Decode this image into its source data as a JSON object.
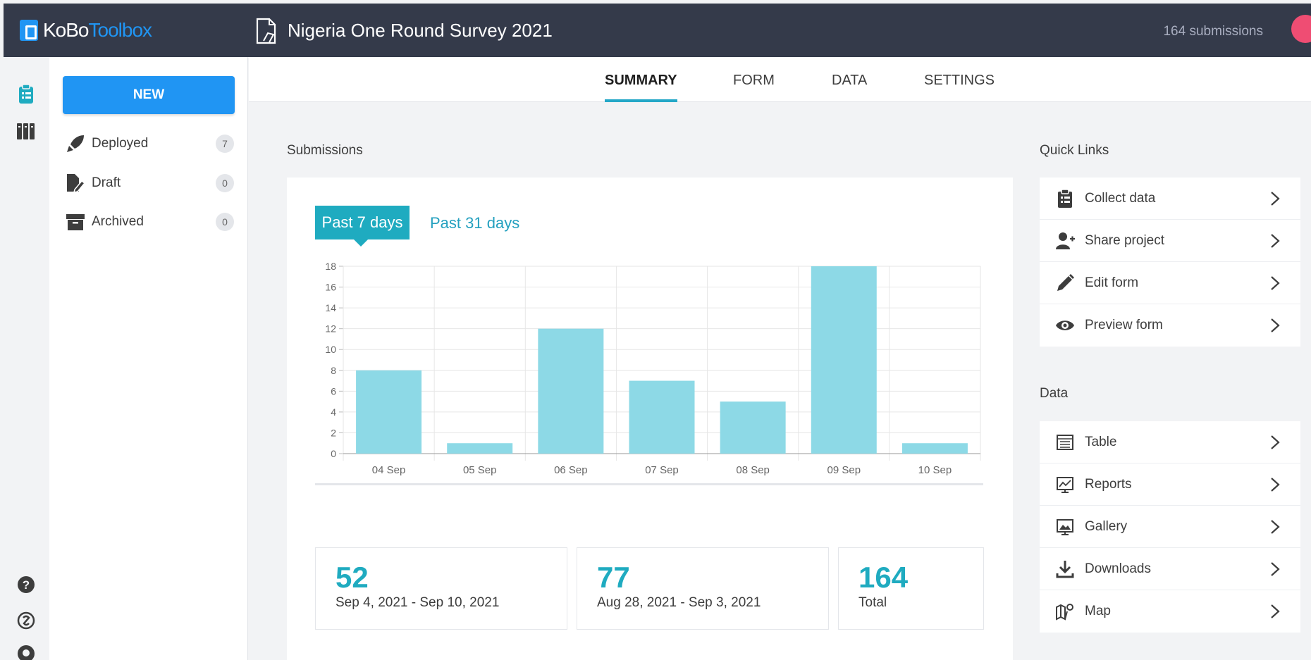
{
  "app": {
    "brand_part1": "KoBo",
    "brand_part2": "Toolbox"
  },
  "header": {
    "project_title": "Nigeria One Round Survey 2021",
    "submission_count": "164 submissions"
  },
  "sidebar": {
    "new_label": "NEW",
    "items": [
      {
        "label": "Deployed",
        "count": "7"
      },
      {
        "label": "Draft",
        "count": "0"
      },
      {
        "label": "Archived",
        "count": "0"
      }
    ]
  },
  "tabs": [
    {
      "label": "SUMMARY",
      "active": true
    },
    {
      "label": "FORM",
      "active": false
    },
    {
      "label": "DATA",
      "active": false
    },
    {
      "label": "SETTINGS",
      "active": false
    }
  ],
  "submissions": {
    "heading": "Submissions",
    "period_active": "Past 7 days",
    "period_other": "Past 31 days",
    "stats": [
      {
        "value": "52",
        "label": "Sep 4, 2021 - Sep 10, 2021"
      },
      {
        "value": "77",
        "label": "Aug 28, 2021 - Sep 3, 2021"
      },
      {
        "value": "164",
        "label": "Total"
      }
    ]
  },
  "chart_data": {
    "type": "bar",
    "categories": [
      "04 Sep",
      "05 Sep",
      "06 Sep",
      "07 Sep",
      "08 Sep",
      "09 Sep",
      "10 Sep"
    ],
    "values": [
      8,
      1,
      12,
      7,
      5,
      18,
      1
    ],
    "ylim": [
      0,
      18
    ],
    "yticks": [
      0,
      2,
      4,
      6,
      8,
      10,
      12,
      14,
      16,
      18
    ],
    "grid": true,
    "bar_color": "#8dd9e6"
  },
  "quick_links": {
    "heading": "Quick Links",
    "items": [
      {
        "label": "Collect data",
        "icon": "clipboard-icon"
      },
      {
        "label": "Share project",
        "icon": "add-user-icon"
      },
      {
        "label": "Edit form",
        "icon": "pencil-icon"
      },
      {
        "label": "Preview form",
        "icon": "eye-icon"
      }
    ]
  },
  "data_links": {
    "heading": "Data",
    "items": [
      {
        "label": "Table",
        "icon": "table-icon"
      },
      {
        "label": "Reports",
        "icon": "reports-icon"
      },
      {
        "label": "Gallery",
        "icon": "gallery-icon"
      },
      {
        "label": "Downloads",
        "icon": "download-icon"
      },
      {
        "label": "Map",
        "icon": "map-icon"
      }
    ]
  },
  "colors": {
    "topbar": "#343a4a",
    "brand_blue": "#2095f3",
    "accent_teal": "#1fabc0"
  }
}
